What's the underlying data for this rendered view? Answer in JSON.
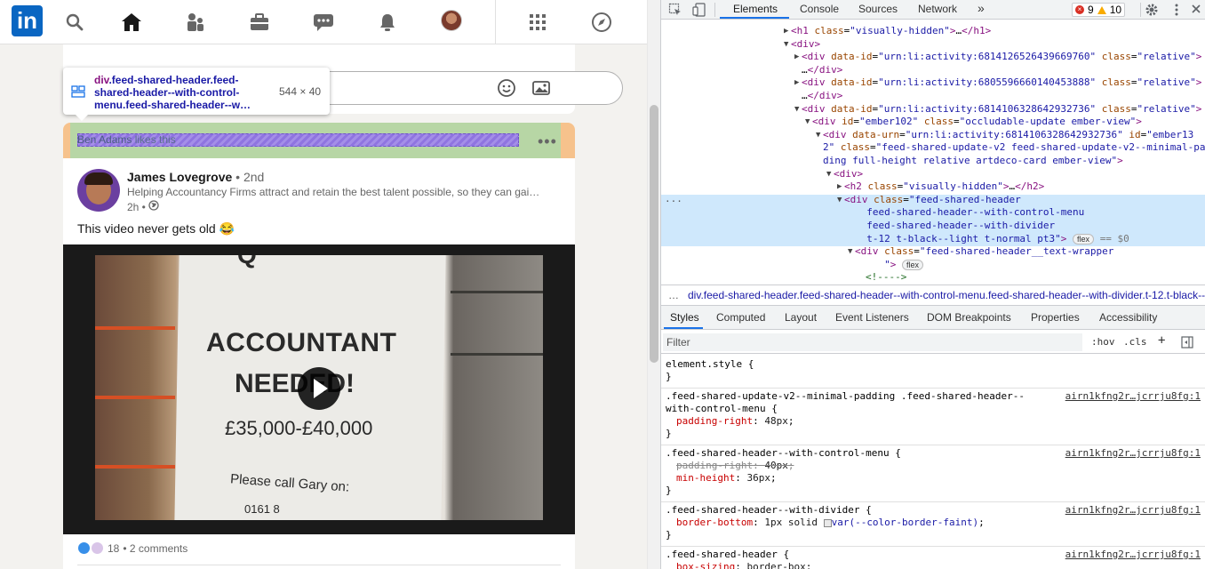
{
  "linkedin": {
    "logo_text": "in",
    "nav_icons": [
      "search-icon",
      "home-icon",
      "my-network-icon",
      "jobs-icon",
      "messaging-icon",
      "notifications-icon",
      "me-avatar",
      "apps-grid-icon",
      "compass-icon"
    ],
    "tooltip": {
      "tag": "div",
      "classes": ".feed-shared-header.feed-shared-header--with-control-menu.feed-shared-header--w…",
      "size": "544 × 40"
    },
    "post": {
      "social_actor": "Ben Adams",
      "social_action": " likes this",
      "menu": "•••",
      "author_name": "James Lovegrove",
      "author_degree": " • 2nd",
      "author_headline": "Helping Accountancy Firms attract and retain the best talent possible, so they can gai…",
      "time": "2h •",
      "text": "This video never gets old 😂",
      "video_sign": {
        "top": "Q",
        "line1": "ACCOUNTANT",
        "line2": "NEEDED!",
        "salary": "£35,000-£40,000",
        "call": "Please call Gary on:",
        "phone": "0161 8"
      },
      "reaction_count": "18",
      "comments": " • 2 comments"
    }
  },
  "devtools": {
    "tabs": [
      "Elements",
      "Console",
      "Sources",
      "Network"
    ],
    "more_tabs": "»",
    "errors": "9",
    "warnings": "10",
    "dom_lines": [
      {
        "indent": 8,
        "tri": "▶",
        "html": "<span class=\"t\">&lt;h1</span> <span class=\"a\">class</span>=<span class=\"v\">\"visually-hidden\"</span><span class=\"t\">&gt;</span>…<span class=\"t\">&lt;/h1&gt;</span>"
      },
      {
        "indent": 8,
        "tri": "▼",
        "html": "<span class=\"t\">&lt;div&gt;</span>"
      },
      {
        "indent": 9,
        "tri": "▶",
        "html": "<span class=\"t\">&lt;div</span> <span class=\"a\">data-id</span>=<span class=\"v\">\"urn:li:activity:6814126526439669760\"</span> <span class=\"a\">class</span>=<span class=\"v\">\"relative\"</span><span class=\"t\">&gt;</span>"
      },
      {
        "indent": 9,
        "tri": "",
        "html": "…<span class=\"t\">&lt;/div&gt;</span>"
      },
      {
        "indent": 9,
        "tri": "▶",
        "html": "<span class=\"t\">&lt;div</span> <span class=\"a\">data-id</span>=<span class=\"v\">\"urn:li:activity:6805596660140453888\"</span> <span class=\"a\">class</span>=<span class=\"v\">\"relative\"</span><span class=\"t\">&gt;</span>"
      },
      {
        "indent": 9,
        "tri": "",
        "html": "…<span class=\"t\">&lt;/div&gt;</span>"
      },
      {
        "indent": 9,
        "tri": "▼",
        "html": "<span class=\"t\">&lt;div</span> <span class=\"a\">data-id</span>=<span class=\"v\">\"urn:li:activity:6814106328642932736\"</span> <span class=\"a\">class</span>=<span class=\"v\">\"relative\"</span><span class=\"t\">&gt;</span>"
      },
      {
        "indent": 10,
        "tri": "▼",
        "html": "<span class=\"t\">&lt;div</span> <span class=\"a\">id</span>=<span class=\"v\">\"ember102\"</span> <span class=\"a\">class</span>=<span class=\"v\">\"occludable-update ember-view\"</span><span class=\"t\">&gt;</span>"
      },
      {
        "indent": 11,
        "tri": "▼",
        "html": "<span class=\"t\">&lt;div</span> <span class=\"a\">data-urn</span>=<span class=\"v\">\"urn:li:activity:6814106328642932736\"</span> <span class=\"a\">id</span>=<span class=\"v\">\"ember13</span>"
      },
      {
        "indent": 11,
        "tri": "",
        "html": "<span class=\"v\">2\"</span> <span class=\"a\">class</span>=<span class=\"v\">\"feed-shared-update-v2 feed-shared-update-v2--minimal-pad</span>"
      },
      {
        "indent": 11,
        "tri": "",
        "html": "<span class=\"v\">ding full-height relative artdeco-card ember-view\"</span><span class=\"t\">&gt;</span>"
      },
      {
        "indent": 12,
        "tri": "▼",
        "html": "<span class=\"t\">&lt;div&gt;</span>"
      },
      {
        "indent": 13,
        "tri": "▶",
        "html": "<span class=\"t\">&lt;h2</span> <span class=\"a\">class</span>=<span class=\"v\">\"visually-hidden\"</span><span class=\"t\">&gt;</span>…<span class=\"t\">&lt;/h2&gt;</span>"
      },
      {
        "indent": 13,
        "tri": "▼",
        "html": "<span class=\"t\">&lt;div</span> <span class=\"a\">class</span>=<span class=\"v\">\"feed-shared-header</span>"
      },
      {
        "indent": 14,
        "tri": "",
        "html": "  <span class=\"v\">feed-shared-header--with-control-menu</span>"
      },
      {
        "indent": 14,
        "tri": "",
        "html": "  <span class=\"v\">feed-shared-header--with-divider</span>"
      },
      {
        "indent": 14,
        "tri": "",
        "html": "  <span class=\"v\">t-12 t-black--light t-normal pt3\"</span><span class=\"t\">&gt;</span> <span class=\"flexpill\">flex</span> <span class=\"dollar0\">== $0</span>"
      },
      {
        "indent": 14,
        "tri": "▼",
        "html": "<span class=\"t\">&lt;div</span> <span class=\"a\">class</span>=<span class=\"v\">\"feed-shared-header__text-wrapper</span>"
      },
      {
        "indent": 14,
        "tri": "",
        "html": "     <span class=\"v\">\"</span><span class=\"t\">&gt;</span> <span class=\"flexpill\">flex</span>"
      },
      {
        "indent": 15,
        "tri": "",
        "html": "<span class=\"c\">&lt;!----&gt;</span>"
      }
    ],
    "breadcrumb": "div.feed-shared-header.feed-shared-header--with-control-menu.feed-shared-header--with-divider.t-12.t-black--light.t-normal.pt3",
    "subtabs": [
      "Styles",
      "Computed",
      "Layout",
      "Event Listeners",
      "DOM Breakpoints",
      "Properties",
      "Accessibility"
    ],
    "filter_placeholder": "Filter",
    "hov": ":hov",
    "cls": ".cls",
    "rules": [
      {
        "selector": "element.style {",
        "src": "",
        "props": [],
        "close": "}"
      },
      {
        "selector": ".feed-shared-update-v2--minimal-padding .feed-shared-header--",
        "selector2": "with-control-menu {",
        "src": "airn1kfng2r…jcrrju8fg:1",
        "props": [
          {
            "name": "padding-right",
            "value": "48px",
            "struck": false
          }
        ],
        "close": "}"
      },
      {
        "selector": ".feed-shared-header--with-control-menu {",
        "src": "airn1kfng2r…jcrrju8fg:1",
        "props": [
          {
            "name": "padding-right",
            "value": "40px",
            "struck": true
          },
          {
            "name": "min-height",
            "value": "36px",
            "struck": false
          }
        ],
        "close": "}"
      },
      {
        "selector": ".feed-shared-header--with-divider {",
        "src": "airn1kfng2r…jcrrju8fg:1",
        "props": [
          {
            "name": "border-bottom",
            "value_prefix": "1px solid ",
            "value_var": "var(--color-border-faint)",
            "struck": false
          }
        ],
        "close": "}"
      },
      {
        "selector": ".feed-shared-header {",
        "src": "airn1kfng2r…jcrrju8fg:1",
        "props": [
          {
            "name": "box-sizing",
            "value": "border-box",
            "struck": false
          }
        ],
        "close": ""
      }
    ]
  }
}
